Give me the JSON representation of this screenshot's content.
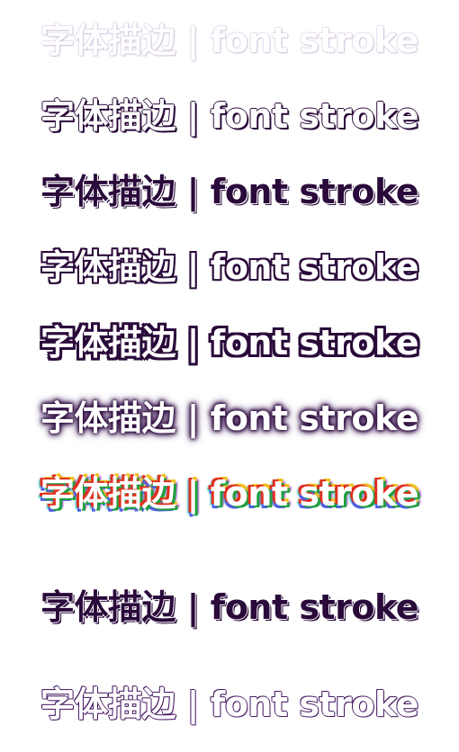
{
  "samples": [
    {
      "text": "字体描边 | font stroke",
      "style": "light-lilac-outline"
    },
    {
      "text": "字体描边 | font stroke",
      "style": "white-thin-dark-stroke"
    },
    {
      "text": "字体描边 | font stroke",
      "style": "dark-fill-offset-stroke"
    },
    {
      "text": "字体描边 | font stroke",
      "style": "white-heavy-dark-stroke"
    },
    {
      "text": "字体描边 | font stroke",
      "style": "white-pixel-dark-stroke"
    },
    {
      "text": "字体描边 | font stroke",
      "style": "white-dark-glow"
    },
    {
      "text": "字体描边 | font stroke",
      "style": "white-rainbow-shadow"
    },
    {
      "text": "字体描边 | font stroke",
      "style": "dark-fill-white-stroke"
    },
    {
      "text": "字体描边 | font stroke",
      "style": "white-thin-purple-stroke"
    }
  ],
  "colors": {
    "stroke_dark": "#2a0a3a",
    "stroke_purple": "#4a1f66",
    "background": "#ffffff"
  }
}
